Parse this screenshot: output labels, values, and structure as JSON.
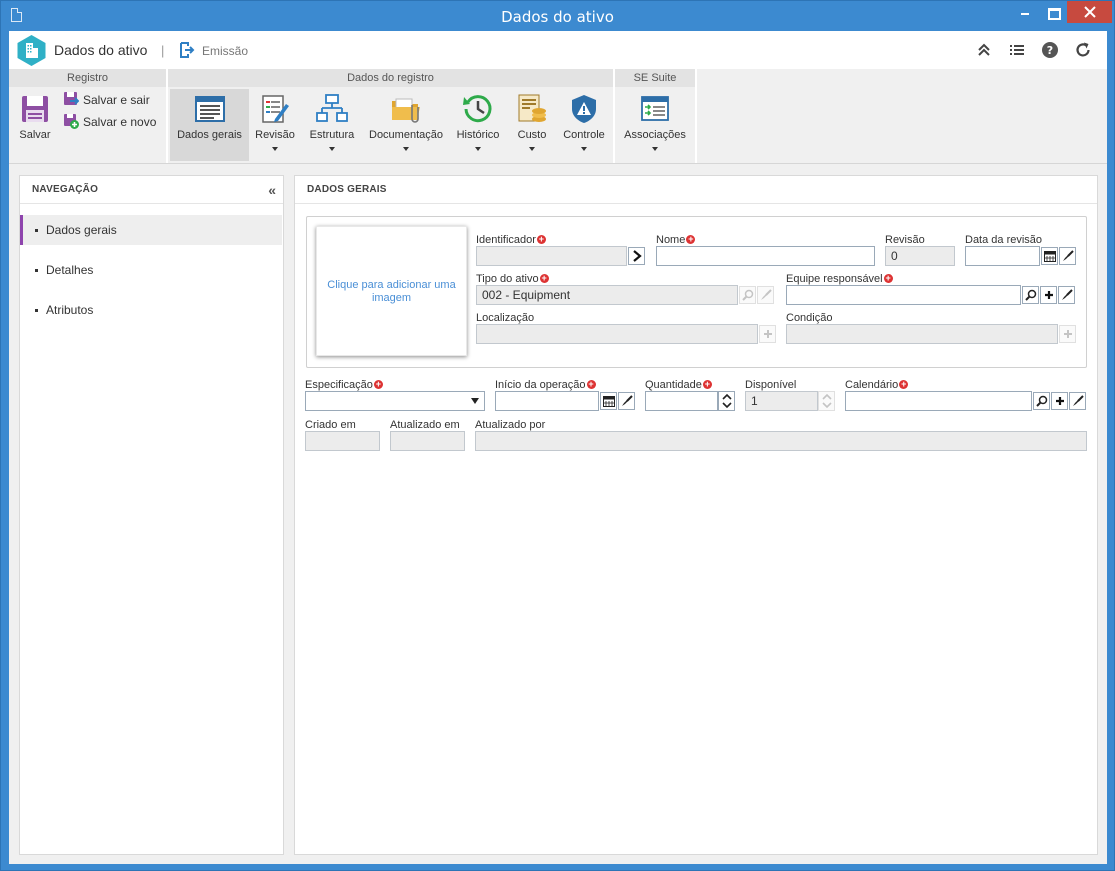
{
  "window": {
    "title": "Dados do ativo"
  },
  "header": {
    "app_title": "Dados do ativo",
    "separator": "|",
    "status_label": "Emissão"
  },
  "ribbon": {
    "groups": [
      {
        "title": "Registro"
      },
      {
        "title": "Dados do registro"
      },
      {
        "title": "SE Suite"
      }
    ],
    "save": "Salvar",
    "save_exit": "Salvar e sair",
    "save_new": "Salvar e novo",
    "buttons": {
      "general": "Dados gerais",
      "revision": "Revisão",
      "structure": "Estrutura",
      "documentation": "Documentação",
      "history": "Histórico",
      "cost": "Custo",
      "control": "Controle",
      "associations": "Associações"
    }
  },
  "nav": {
    "title": "NAVEGAÇÃO",
    "items": [
      {
        "label": "Dados gerais",
        "active": true
      },
      {
        "label": "Detalhes"
      },
      {
        "label": "Atributos"
      }
    ]
  },
  "main": {
    "title": "DADOS GERAIS",
    "image_placeholder": "Clique para adicionar uma imagem",
    "fields": {
      "identificador": {
        "label": "Identificador",
        "value": ""
      },
      "nome": {
        "label": "Nome",
        "value": ""
      },
      "revisao": {
        "label": "Revisão",
        "value": "0"
      },
      "data_revisao": {
        "label": "Data da revisão",
        "value": ""
      },
      "tipo_ativo": {
        "label": "Tipo do ativo",
        "value": "002 - Equipment"
      },
      "equipe": {
        "label": "Equipe responsável",
        "value": ""
      },
      "localizacao": {
        "label": "Localização",
        "value": ""
      },
      "condicao": {
        "label": "Condição",
        "value": ""
      },
      "especificacao": {
        "label": "Especificação",
        "value": ""
      },
      "inicio_operacao": {
        "label": "Início da operação",
        "value": ""
      },
      "quantidade": {
        "label": "Quantidade",
        "value": ""
      },
      "disponivel": {
        "label": "Disponível",
        "value": "1"
      },
      "calendario": {
        "label": "Calendário",
        "value": ""
      },
      "criado_em": {
        "label": "Criado em",
        "value": ""
      },
      "atualizado_em": {
        "label": "Atualizado em",
        "value": ""
      },
      "atualizado_por": {
        "label": "Atualizado por",
        "value": ""
      }
    }
  },
  "colors": {
    "titlebar": "#3c8ad0",
    "accent": "#8e44ad",
    "required": "#dd3333",
    "link": "#4a8fd6"
  }
}
